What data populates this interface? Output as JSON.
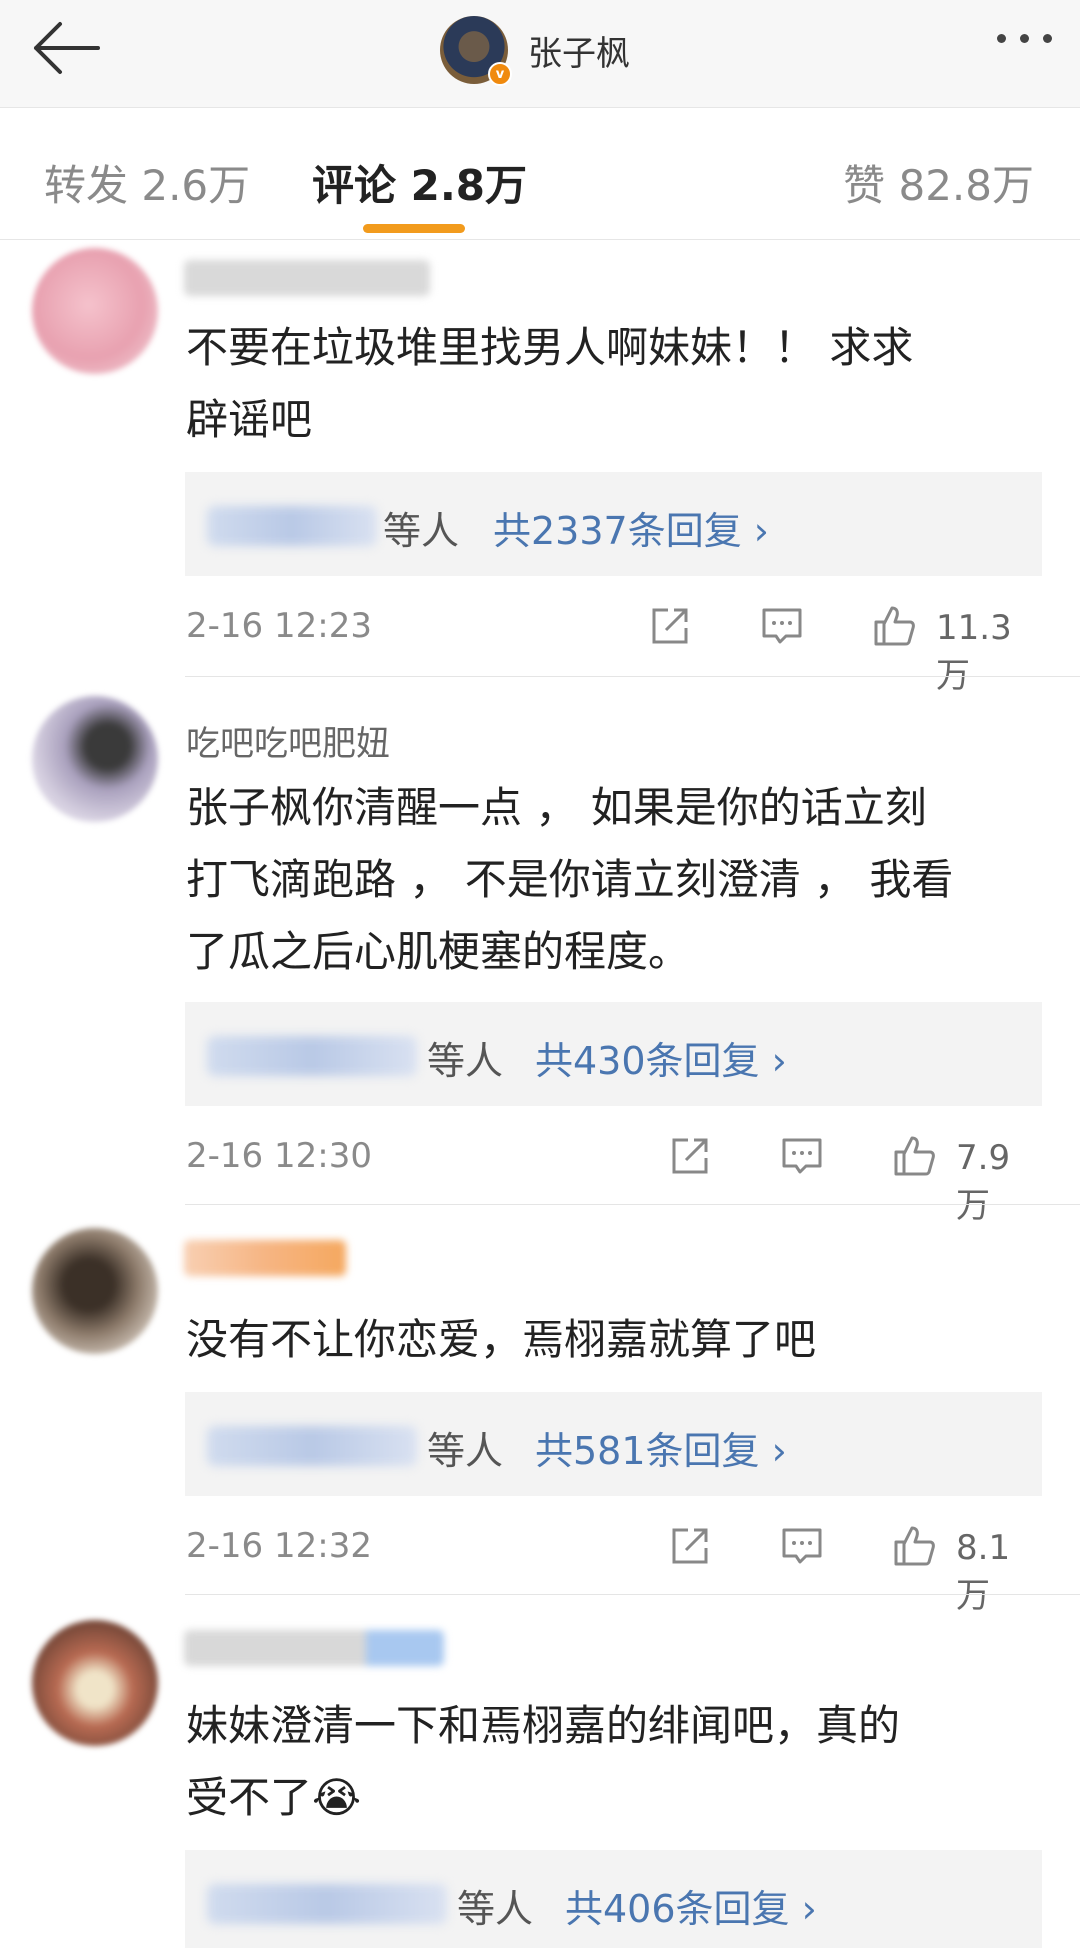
{
  "header": {
    "username": "张子枫"
  },
  "tabs": [
    {
      "label": "转发 2.6万"
    },
    {
      "label": "评论 2.8万"
    },
    {
      "label": "赞 82.8万"
    }
  ],
  "comments": [
    {
      "username": "",
      "text_lines": [
        "不要在垃圾堆里找男人啊妹妹！！ 求求",
        "辟谣吧"
      ],
      "reply_suffix": "等人",
      "reply_count": "共2337条回复 ›",
      "time": "2-16 12:23",
      "likes": "11.3万"
    },
    {
      "username": "吃吧吃吧肥妞",
      "text_lines": [
        "张子枫你清醒一点 ， 如果是你的话立刻",
        "打飞滴跑路 ， 不是你请立刻澄清 ， 我看",
        "了瓜之后心肌梗塞的程度。"
      ],
      "reply_suffix": "等人",
      "reply_count": "共430条回复 ›",
      "time": "2-16 12:30",
      "likes": "7.9万"
    },
    {
      "username": "",
      "text_lines": [
        "没有不让你恋爱，焉栩嘉就算了吧"
      ],
      "reply_suffix": "等人",
      "reply_count": "共581条回复 ›",
      "time": "2-16 12:32",
      "likes": "8.1万"
    },
    {
      "username": "",
      "text_lines": [
        "妹妹澄清一下和焉栩嘉的绯闻吧，真的",
        "受不了😭"
      ],
      "reply_suffix": "等人",
      "reply_count": "共406条回复 ›"
    }
  ],
  "icons": {
    "back": "arrow-left-icon",
    "more": "more-dots-icon",
    "repost": "share-icon",
    "comment": "comment-icon",
    "like": "thumbs-up-icon"
  },
  "colors": {
    "accent": "#f29b1d",
    "link": "#4a76b0"
  }
}
